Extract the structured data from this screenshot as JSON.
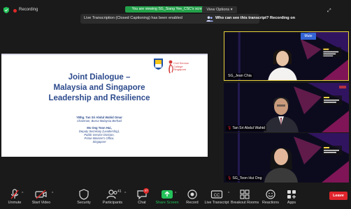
{
  "topbar": {
    "recording_label": "Recording",
    "viewing_banner": "You are viewing SG_Siang Yee_CSC's screen",
    "view_options_label": "View Options",
    "caret": "▾"
  },
  "transcript_bar": {
    "notice": "Live Transcription (Closed Captioning) has been enabled",
    "question": "Who can see this transcript? Recording on"
  },
  "slide": {
    "college_name": "Civil Service College Singapore",
    "title_lines": [
      "Joint Dialogue –",
      "Malaysia and Singapore",
      "Leadership and Resilience"
    ],
    "speakers": [
      {
        "name": "YBhg. Tan Sri Abdul Wahid Omar",
        "role_lines": [
          "Chairman, Bursa Malaysia Berhad"
        ]
      },
      {
        "name": "Ms Ong Toon Hui,",
        "role_lines": [
          "Deputy Secretary (Leadership),",
          "Public Service Division,",
          "Prime Minister's Office,",
          "Singapore"
        ]
      }
    ]
  },
  "participants": [
    {
      "label": "SG_Jean Chia",
      "active": true,
      "muted": false
    },
    {
      "label": "Tan Sri Abdul Wahid",
      "active": false,
      "muted": true
    },
    {
      "label": "SG_Toon Hui Ong",
      "active": false,
      "muted": true
    }
  ],
  "mute_badge": "Mute",
  "toolbar": {
    "items": [
      {
        "label": "Unmute",
        "icon": "microphone-muted-icon"
      },
      {
        "label": "Start Video",
        "icon": "video-off-icon"
      },
      {
        "label": "Security",
        "icon": "shield-icon"
      },
      {
        "label": "Participants",
        "icon": "participants-icon"
      },
      {
        "label": "Chat",
        "icon": "chat-icon"
      },
      {
        "label": "Share Screen",
        "icon": "share-screen-icon"
      },
      {
        "label": "Record",
        "icon": "record-icon"
      },
      {
        "label": "Live Transcript",
        "icon": "cc-icon"
      },
      {
        "label": "Breakout Rooms",
        "icon": "breakout-rooms-icon"
      },
      {
        "label": "Reactions",
        "icon": "reactions-icon"
      },
      {
        "label": "Apps",
        "icon": "apps-icon"
      }
    ],
    "participants_count": "41",
    "chat_badge": "47",
    "leave_label": "Leave",
    "caret": "^"
  },
  "colors": {
    "accent_green": "#23a14a",
    "leave_red": "#e0242c",
    "slide_title_blue": "#2c4a8c",
    "active_border": "#e8d33a"
  }
}
